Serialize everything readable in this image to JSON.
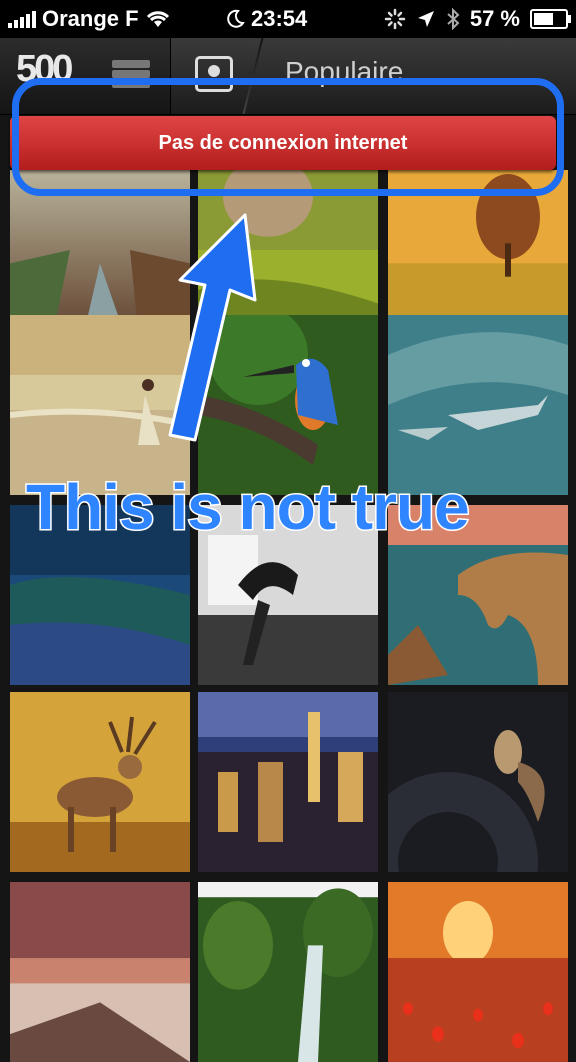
{
  "status_bar": {
    "carrier": "Orange F",
    "time": "23:54",
    "battery": "57 %",
    "battery_level": 0.57
  },
  "navbar": {
    "logo": "500",
    "title": "Populaire"
  },
  "banner": {
    "message": "Pas de connexion internet"
  },
  "annotation": {
    "text": "This is not true"
  },
  "icons": [
    "signal-icon",
    "wifi-icon",
    "moon-icon",
    "activity-icon",
    "location-icon",
    "bluetooth-icon",
    "battery-icon",
    "stack-icon",
    "photo-icon"
  ],
  "colors": {
    "banner": "#c62a2a",
    "annotation": "#2f85ff",
    "highlight": "#1f6df0"
  }
}
